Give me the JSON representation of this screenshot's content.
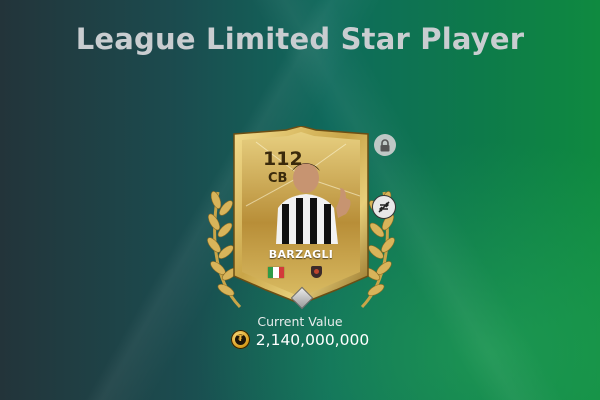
{
  "screen": {
    "title": "League Limited Star Player"
  },
  "player_card": {
    "rating": "112",
    "position": "CB",
    "name": "BARZAGLI",
    "nationality_flag_colors": [
      "#2e9b47",
      "#ffffff",
      "#d33a3a"
    ],
    "card_colors": {
      "gold_light": "#f2d985",
      "gold_mid": "#c9a548",
      "gold_dark": "#7a5a1c"
    }
  },
  "value": {
    "label": "Current Value",
    "amount": "2,140,000,000",
    "currency_icon": "coin-icon"
  },
  "icons": {
    "lock": "lock-icon",
    "untradable": "untradable-icon"
  }
}
